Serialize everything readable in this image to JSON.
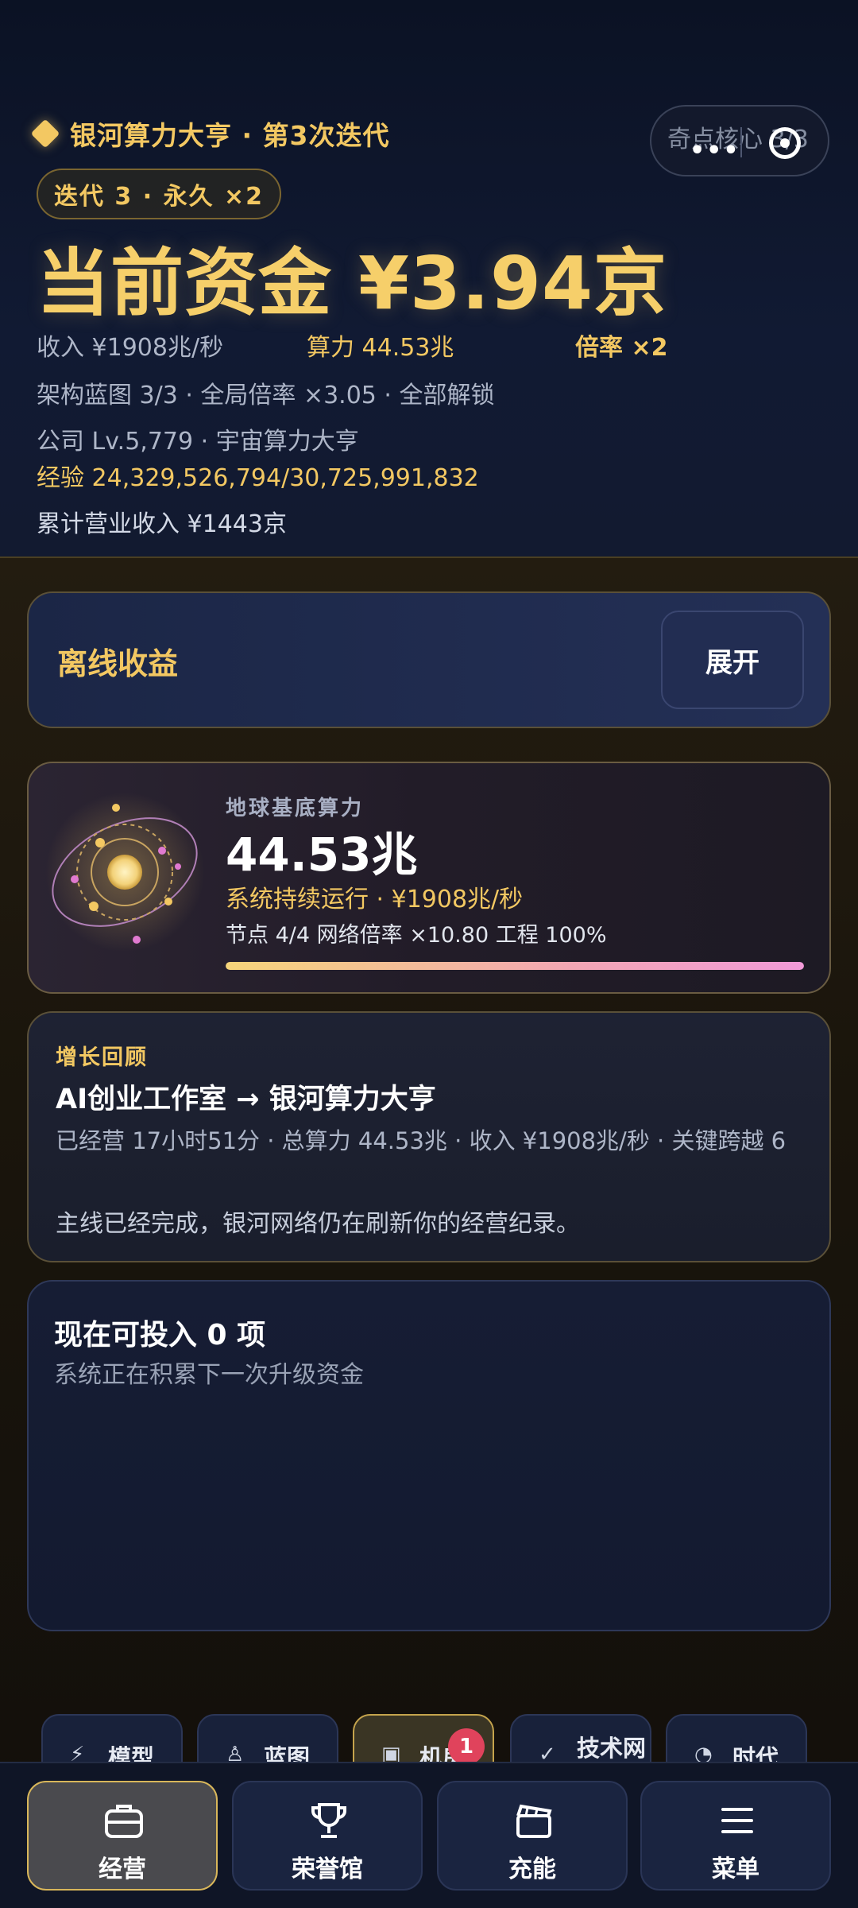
{
  "header": {
    "game_title": "银河算力大亨 · 第3次迭代",
    "top_pill_text": "奇点核心 3/3",
    "iteration_badge": "迭代 3 · 永久 ×2",
    "funds": "当前资金 ¥3.94京",
    "income": "收入 ¥1908兆/秒",
    "compute": "算力 44.53兆",
    "multiplier": "倍率 ×2",
    "blueprint": "架构蓝图 3/3 · 全局倍率 ×3.05 · 全部解锁",
    "company": "公司 Lv.5,779 · 宇宙算力大亨",
    "experience": "经验 24,329,526,794/30,725,991,832",
    "total_revenue": "累计营业收入 ¥1443京"
  },
  "offline": {
    "label": "离线收益",
    "button": "展开"
  },
  "earth": {
    "kicker": "地球基底算力",
    "value": "44.53兆",
    "running": "系统持续运行 · ¥1908兆/秒",
    "meta": "节点 4/4   网络倍率 ×10.80   工程 100%",
    "progress": 1.0
  },
  "growth": {
    "kicker": "增长回顾",
    "path": "AI创业工作室 → 银河算力大亨",
    "summary": "已经营 17小时51分 · 总算力 44.53兆 · 收入 ¥1908兆/秒 · 关键跨越 6",
    "note": "主线已经完成，银河网络仍在刷新你的经营纪录。"
  },
  "invest": {
    "title": "现在可投入 0 项",
    "subtitle": "系统正在积累下一次升级资金"
  },
  "subnav": {
    "tabs": [
      {
        "label": "模型",
        "icon": "bolt-icon"
      },
      {
        "label": "蓝图",
        "icon": "blueprint-icon"
      },
      {
        "label": "机房",
        "icon": "server-icon",
        "badge": "1"
      },
      {
        "label": "技术网",
        "icon": "check-icon"
      },
      {
        "label": "时代",
        "icon": "gauge-icon"
      }
    ]
  },
  "bottom_nav": {
    "items": [
      {
        "label": "经营",
        "icon": "briefcase-icon",
        "active": true
      },
      {
        "label": "荣誉馆",
        "icon": "trophy-icon",
        "active": false
      },
      {
        "label": "充能",
        "icon": "clapper-icon",
        "active": false
      },
      {
        "label": "菜单",
        "icon": "menu-icon",
        "active": false
      }
    ]
  },
  "colors": {
    "accent_gold": "#f3c862",
    "badge_red": "#e0435c",
    "background": "#0b1120"
  }
}
